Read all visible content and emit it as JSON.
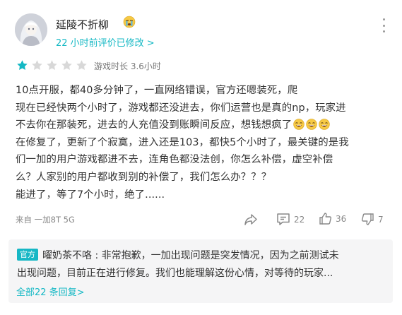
{
  "user": {
    "name": "延陵不折柳",
    "meta": "22 小时前评价已修改 >"
  },
  "rating": {
    "value": 1,
    "max": 5,
    "filled_color": "#14b8c4",
    "empty_color": "#d8d8d8",
    "play_time": "游戏时长 3.6小时"
  },
  "review": {
    "lines": [
      "10点开服，都40多分钟了，一直网络错误，官方还嗯装死，爬",
      "现在已经快两个小时了，游戏都还没进去，你们运营也是真的np，玩家进",
      "不去你在那装死，进去的人充值没到账瞬间反应，想钱想疯了",
      "在修复了，更新了个寂寞，进入还是103，都快5个小时了，最关键的是我",
      "们一加的用户游戏都进不去，连角色都没法创，你怎么补偿，虚空补偿",
      "么？人家别的用户都收到别的补偿了，我们怎么办？？？",
      "能进了，等了7个小时，绝了......"
    ]
  },
  "footer": {
    "device": "来自 一加8T 5G",
    "comment_count": "22",
    "like_count": "36",
    "dislike_count": "7"
  },
  "reply": {
    "badge": "官方",
    "line1": "曜奶茶不咯 : 非常抱歉，一加出现问题是突发情况，因为之前测试未",
    "line2": "出现问题，目前正在进行修复。我们也能理解这份心情，对等待的玩家...",
    "all_replies": "全部22 条回复>"
  }
}
